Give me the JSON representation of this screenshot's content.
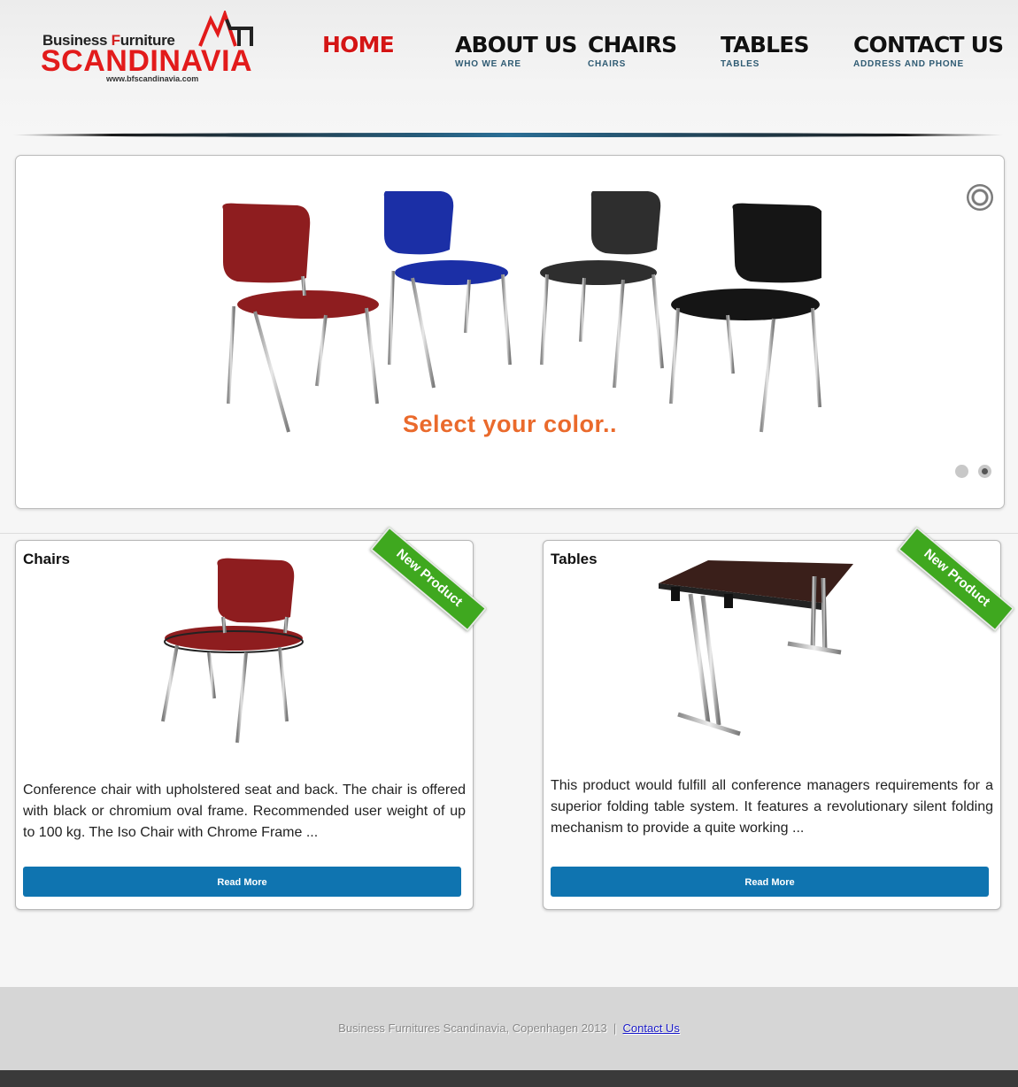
{
  "logo": {
    "line1_a": "Business ",
    "line1_b": "F",
    "line1_c": "urniture",
    "line2": "SCANDINAVIA",
    "url": "www.bfscandinavia.com"
  },
  "nav": [
    {
      "label": "HOME",
      "sub": ""
    },
    {
      "label": "ABOUT US",
      "sub": "WHO WE ARE"
    },
    {
      "label": "CHAIRS",
      "sub": "CHAIRS"
    },
    {
      "label": "TABLES",
      "sub": "TABLES"
    },
    {
      "label": "CONTACT US",
      "sub": "ADDRESS AND PHONE"
    }
  ],
  "slider": {
    "caption": "Select your color..",
    "chair_colors": [
      "#8e1d1f",
      "#1b2fa6",
      "#2e2e2e",
      "#151515"
    ]
  },
  "cards": [
    {
      "title": "Chairs",
      "ribbon": "New Product",
      "description": "Conference chair with upholstered seat and back. The chair is offered with black or chromium oval frame. Recommended user weight of up to 100 kg. The Iso Chair with Chrome Frame ...",
      "button": "Read More"
    },
    {
      "title": "Tables",
      "ribbon": "New Product",
      "description": "This product would fulfill all conference managers requirements for a superior folding table system. It features a revolutionary silent folding mechanism to provide a quite working ...",
      "button": "Read More"
    }
  ],
  "footer": {
    "text": "Business Furnitures Scandinavia, Copenhagen 2013  |  ",
    "link": "Contact Us"
  },
  "colors": {
    "accent_red": "#e21b1b",
    "caption_orange": "#ea6a2c",
    "button_blue": "#0f74b0",
    "ribbon_green": "#3fa81f"
  }
}
